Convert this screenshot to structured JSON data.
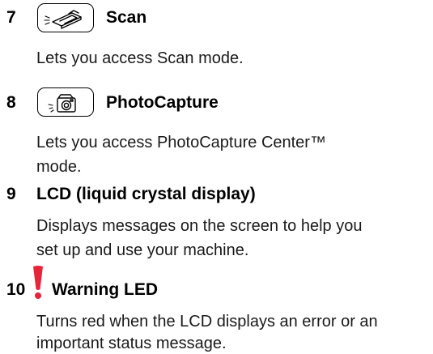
{
  "items": [
    {
      "number": "7",
      "title": "Scan",
      "icon": "scan-icon",
      "description": "Lets you access Scan mode."
    },
    {
      "number": "8",
      "title": "PhotoCapture",
      "icon": "camera-icon",
      "description_lines": [
        "Lets you access PhotoCapture Center™",
        "mode."
      ]
    },
    {
      "number": "9",
      "title": "LCD (liquid crystal display)",
      "description_lines": [
        "Displays messages on the screen to help you",
        "set up and use your machine."
      ]
    },
    {
      "number": "10",
      "title": "Warning LED",
      "icon": "warning-led-icon",
      "icon_color": "#e8243a",
      "description_lines": [
        "Turns red when the LCD displays an error or an",
        "important status message."
      ]
    }
  ]
}
